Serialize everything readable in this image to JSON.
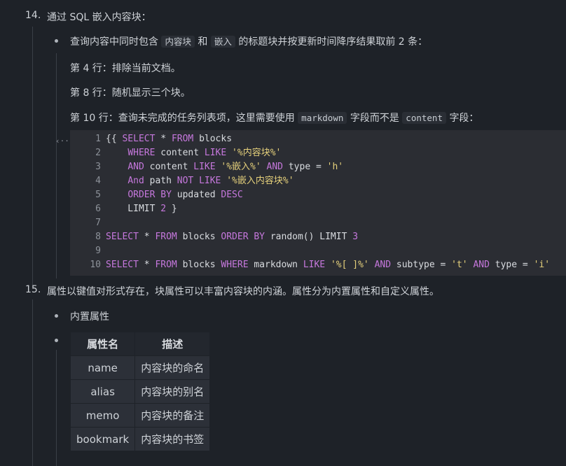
{
  "item14": {
    "number": "14.",
    "title": "通过 SQL 嵌入内容块：",
    "bullet": {
      "pre": "查询内容中同时包含",
      "code1": "内容块",
      "mid1": "和",
      "code2": "嵌入",
      "post": "的标题块并按更新时间降序结果取前 2 条："
    },
    "notes": [
      "第 4 行：排除当前文档。",
      "第 8 行：随机显示三个块。"
    ],
    "note3": {
      "pre": "第 10 行：查询未完成的任务列表项，这里需要使用",
      "code1": "markdown",
      "mid": "字段而不是",
      "code2": "content",
      "post": "字段："
    },
    "code_icon": "‹··›",
    "code_lines": [
      "1",
      "2",
      "3",
      "4",
      "5",
      "6",
      "7",
      "8",
      "9",
      "10"
    ]
  },
  "item15": {
    "number": "15.",
    "title": "属性以键值对形式存在，块属性可以丰富内容块的内涵。属性分为内置属性和自定义属性。",
    "bullet1": "内置属性",
    "table": {
      "headers": [
        "属性名",
        "描述"
      ],
      "rows": [
        [
          "name",
          "内容块的命名"
        ],
        [
          "alias",
          "内容块的别名"
        ],
        [
          "memo",
          "内容块的备注"
        ],
        [
          "bookmark",
          "内容块的书签"
        ]
      ]
    }
  }
}
